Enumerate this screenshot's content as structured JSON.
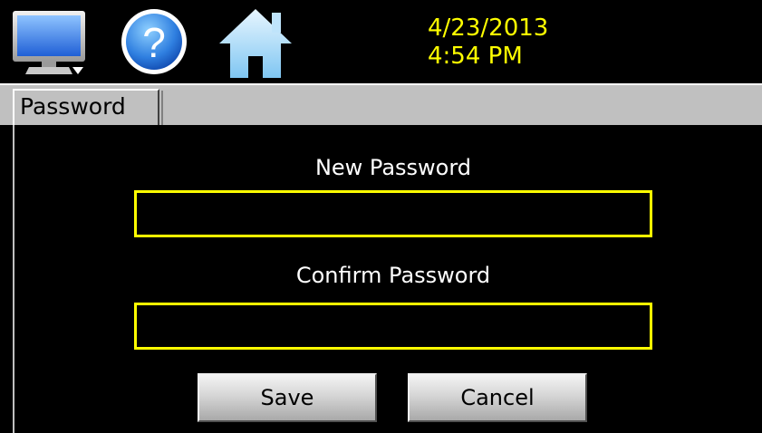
{
  "header": {
    "date": "4/23/2013",
    "time": "4:54 PM",
    "icons": [
      "monitor-icon",
      "help-icon",
      "home-icon"
    ]
  },
  "tabs": [
    {
      "label": "Password",
      "active": true
    }
  ],
  "form": {
    "new_password_label": "New Password",
    "new_password_value": "",
    "confirm_password_label": "Confirm Password",
    "confirm_password_value": ""
  },
  "buttons": {
    "save_label": "Save",
    "cancel_label": "Cancel"
  },
  "colors": {
    "background": "#000000",
    "accent": "#ffff00",
    "tab_bar": "#c0c0c0"
  }
}
